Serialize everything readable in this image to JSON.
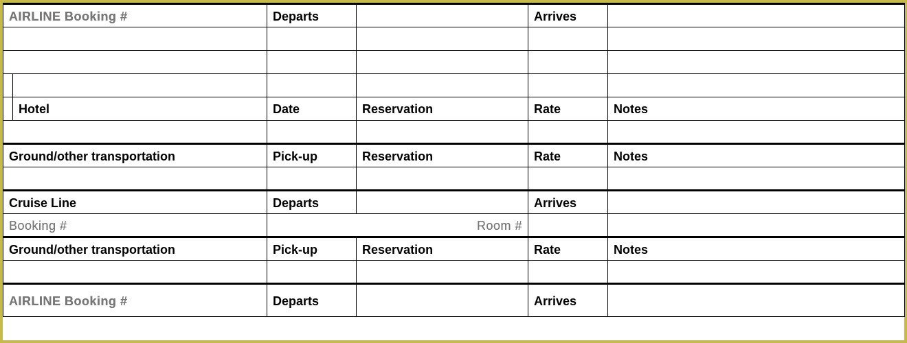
{
  "sections": {
    "airline1": {
      "title": "AIRLINE   Booking #",
      "departs": "Departs",
      "arrives": "Arrives"
    },
    "hotel": {
      "title": "Hotel",
      "date": "Date",
      "reservation": "Reservation",
      "rate": "Rate",
      "notes": "Notes"
    },
    "ground1": {
      "title": "Ground/other transportation",
      "pickup": "Pick-up",
      "reservation": "Reservation",
      "rate": "Rate",
      "notes": "Notes"
    },
    "cruise": {
      "title": "Cruise Line",
      "departs": "Departs",
      "arrives": "Arrives",
      "booking": "Booking #",
      "room": "Room #"
    },
    "ground2": {
      "title": "Ground/other transportation",
      "pickup": "Pick-up",
      "reservation": "Reservation",
      "rate": "Rate",
      "notes": "Notes"
    },
    "airline2": {
      "title": "AIRLINE   Booking #",
      "departs": "Departs",
      "arrives": "Arrives"
    }
  }
}
